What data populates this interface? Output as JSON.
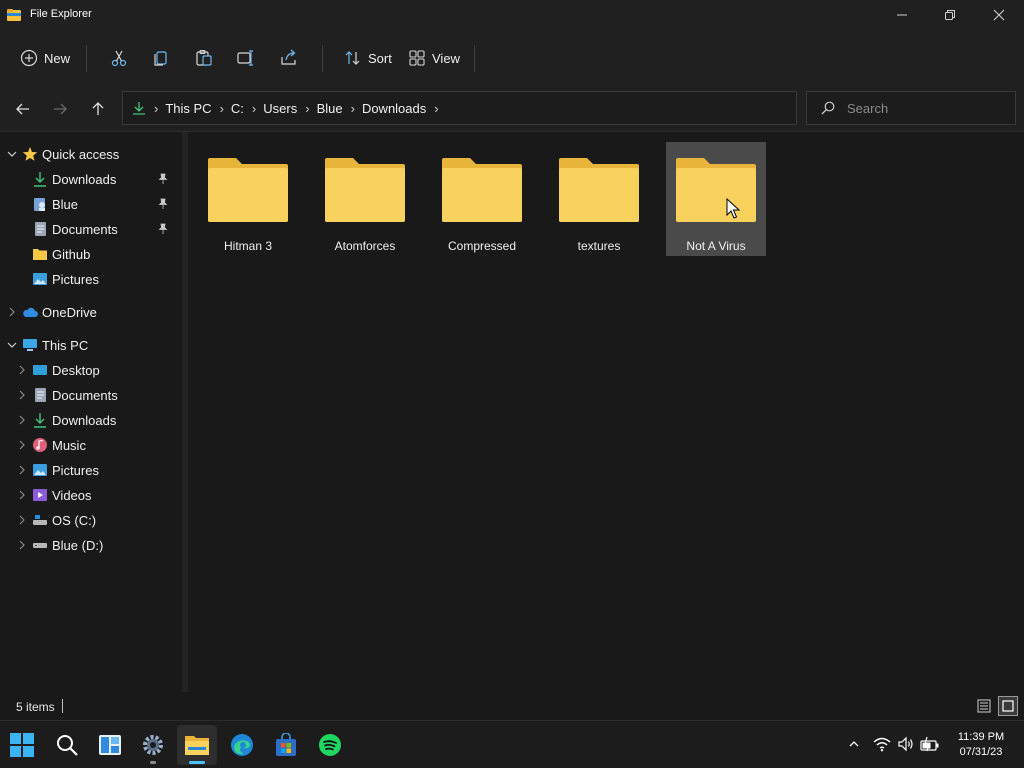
{
  "window": {
    "title": "File Explorer"
  },
  "toolbar": {
    "new_label": "New",
    "sort_label": "Sort",
    "view_label": "View",
    "icons": [
      "cut-icon",
      "copy-icon",
      "paste-icon",
      "rename-icon",
      "share-icon"
    ]
  },
  "address": {
    "crumbs": [
      "This PC",
      "C:",
      "Users",
      "Blue",
      "Downloads"
    ]
  },
  "search": {
    "placeholder": "Search"
  },
  "sidebar": {
    "quick_access": {
      "label": "Quick access",
      "items": [
        {
          "label": "Downloads",
          "pinned": true
        },
        {
          "label": "Blue",
          "pinned": true
        },
        {
          "label": "Documents",
          "pinned": true
        },
        {
          "label": "Github",
          "pinned": false
        },
        {
          "label": "Pictures",
          "pinned": false
        }
      ]
    },
    "onedrive": {
      "label": "OneDrive"
    },
    "this_pc": {
      "label": "This PC",
      "items": [
        {
          "label": "Desktop"
        },
        {
          "label": "Documents"
        },
        {
          "label": "Downloads"
        },
        {
          "label": "Music"
        },
        {
          "label": "Pictures"
        },
        {
          "label": "Videos"
        },
        {
          "label": "OS (C:)"
        },
        {
          "label": "Blue (D:)"
        }
      ]
    }
  },
  "content": {
    "items": [
      {
        "name": "Hitman 3",
        "selected": false
      },
      {
        "name": "Atomforces",
        "selected": false
      },
      {
        "name": "Compressed",
        "selected": false
      },
      {
        "name": "textures",
        "selected": false
      },
      {
        "name": "Not A Virus",
        "selected": true
      }
    ]
  },
  "status": {
    "item_count": "5 items"
  },
  "clock": {
    "time": "11:39 PM",
    "date": "07/31/23"
  },
  "colors": {
    "background": "#191919",
    "chrome": "#202020",
    "folder_yellow": "#f8d25c",
    "accent": "#4cc2ff",
    "selection": "#4a4a4a"
  }
}
